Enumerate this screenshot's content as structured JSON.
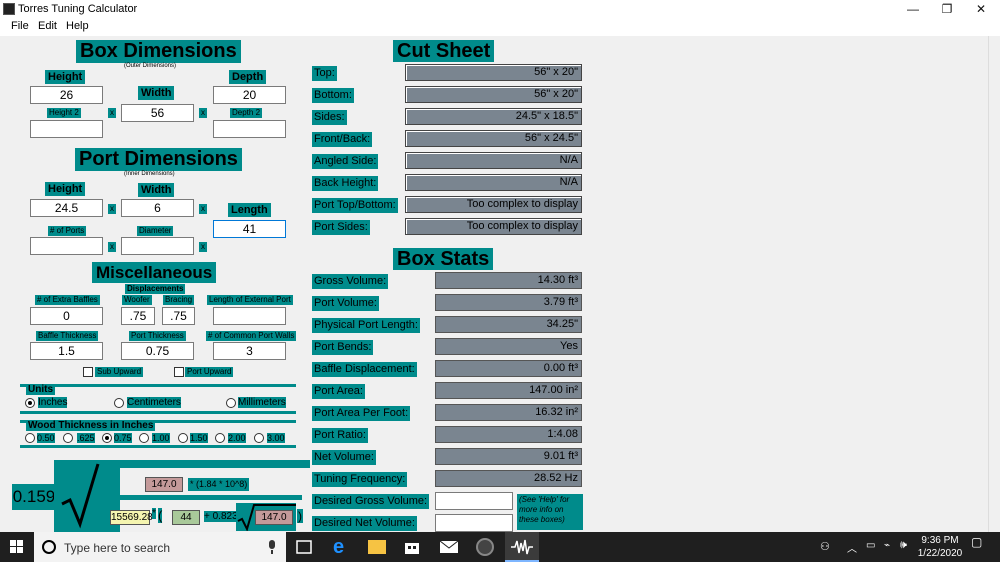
{
  "window": {
    "title": "Torres Tuning Calculator",
    "min": "—",
    "restore": "❐",
    "close": "✕"
  },
  "menu": {
    "file": "File",
    "edit": "Edit",
    "help": "Help"
  },
  "box": {
    "title": "Box Dimensions",
    "subtitle": "(Outer Dimensions)",
    "height_label": "Height",
    "width_label": "Width",
    "depth_label": "Depth",
    "height": "26",
    "width": "56",
    "depth": "20",
    "height2_label": "Height 2",
    "depth2_label": "Depth 2",
    "x": "x"
  },
  "port": {
    "title": "Port Dimensions",
    "subtitle": "(Inner Dimensions)",
    "height_label": "Height",
    "width_label": "Width",
    "length_label": "Length",
    "height": "24.5",
    "width": "6",
    "length": "41",
    "ports_label": "# of Ports",
    "diameter_label": "Diameter"
  },
  "misc": {
    "title": "Miscellaneous",
    "displacements": "Displacements",
    "extra_baffles_label": "# of Extra Baffles",
    "extra_baffles": "0",
    "woofer_label": "Woofer",
    "woofer": ".75",
    "bracing_label": "Bracing",
    "bracing": ".75",
    "ext_port_label": "Length of External Port",
    "baffle_thick_label": "Baffle Thickness",
    "baffle_thick": "1.5",
    "port_thick_label": "Port Thickness",
    "port_thick": "0.75",
    "common_walls_label": "# of Common Port Walls",
    "common_walls": "3",
    "sub_upward": "Sub Upward",
    "port_upward": "Port Upward"
  },
  "units": {
    "title": "Units",
    "inches": "Inches",
    "cm": "Centimeters",
    "mm": "Millimeters"
  },
  "wood": {
    "title": "Wood Thickness in Inches",
    "opts": [
      "0.50",
      ".625",
      "0.75",
      "1.00",
      "1.50",
      "2.00",
      "3.00"
    ]
  },
  "formula": {
    "const": "0.159",
    "v147a": "147.0",
    "exp": "* (1.84 * 10^8)",
    "v15569": "15569.28",
    "star": "*",
    "lp": "(",
    "v44": "44",
    "plus": "+ 0.823",
    "v147b": "147.0",
    "rp": ")"
  },
  "cut": {
    "title": "Cut Sheet",
    "rows": [
      {
        "label": "Top:",
        "value": "56\" x 20\""
      },
      {
        "label": "Bottom:",
        "value": "56\" x 20\""
      },
      {
        "label": "Sides:",
        "value": "24.5\" x 18.5\""
      },
      {
        "label": "Front/Back:",
        "value": "56\" x 24.5\""
      },
      {
        "label": "Angled Side:",
        "value": "N/A"
      },
      {
        "label": "Back Height:",
        "value": "N/A"
      },
      {
        "label": "Port Top/Bottom:",
        "value": "Too complex to display"
      },
      {
        "label": "Port Sides:",
        "value": "Too complex to display"
      }
    ]
  },
  "stats": {
    "title": "Box Stats",
    "rows": [
      {
        "label": "Gross Volume:",
        "value": "14.30 ft³"
      },
      {
        "label": "Port Volume:",
        "value": "3.79 ft³"
      },
      {
        "label": "Physical Port Length:",
        "value": "34.25\""
      },
      {
        "label": "Port Bends:",
        "value": "Yes"
      },
      {
        "label": "Baffle Displacement:",
        "value": "0.00 ft³"
      },
      {
        "label": "Port Area:",
        "value": "147.00 in²"
      },
      {
        "label": "Port Area Per Foot:",
        "value": "16.32 in²"
      },
      {
        "label": "Port Ratio:",
        "value": "1:4.08"
      },
      {
        "label": "Net Volume:",
        "value": "9.01 ft³"
      },
      {
        "label": "Tuning Frequency:",
        "value": "28.52 Hz"
      }
    ],
    "desired_gross": "Desired Gross Volume:",
    "desired_net": "Desired Net Volume:",
    "help_note": "(See 'Help' for more info on these boxes)"
  },
  "taskbar": {
    "search": "Type here to search",
    "time": "9:36 PM",
    "date": "1/22/2020"
  }
}
